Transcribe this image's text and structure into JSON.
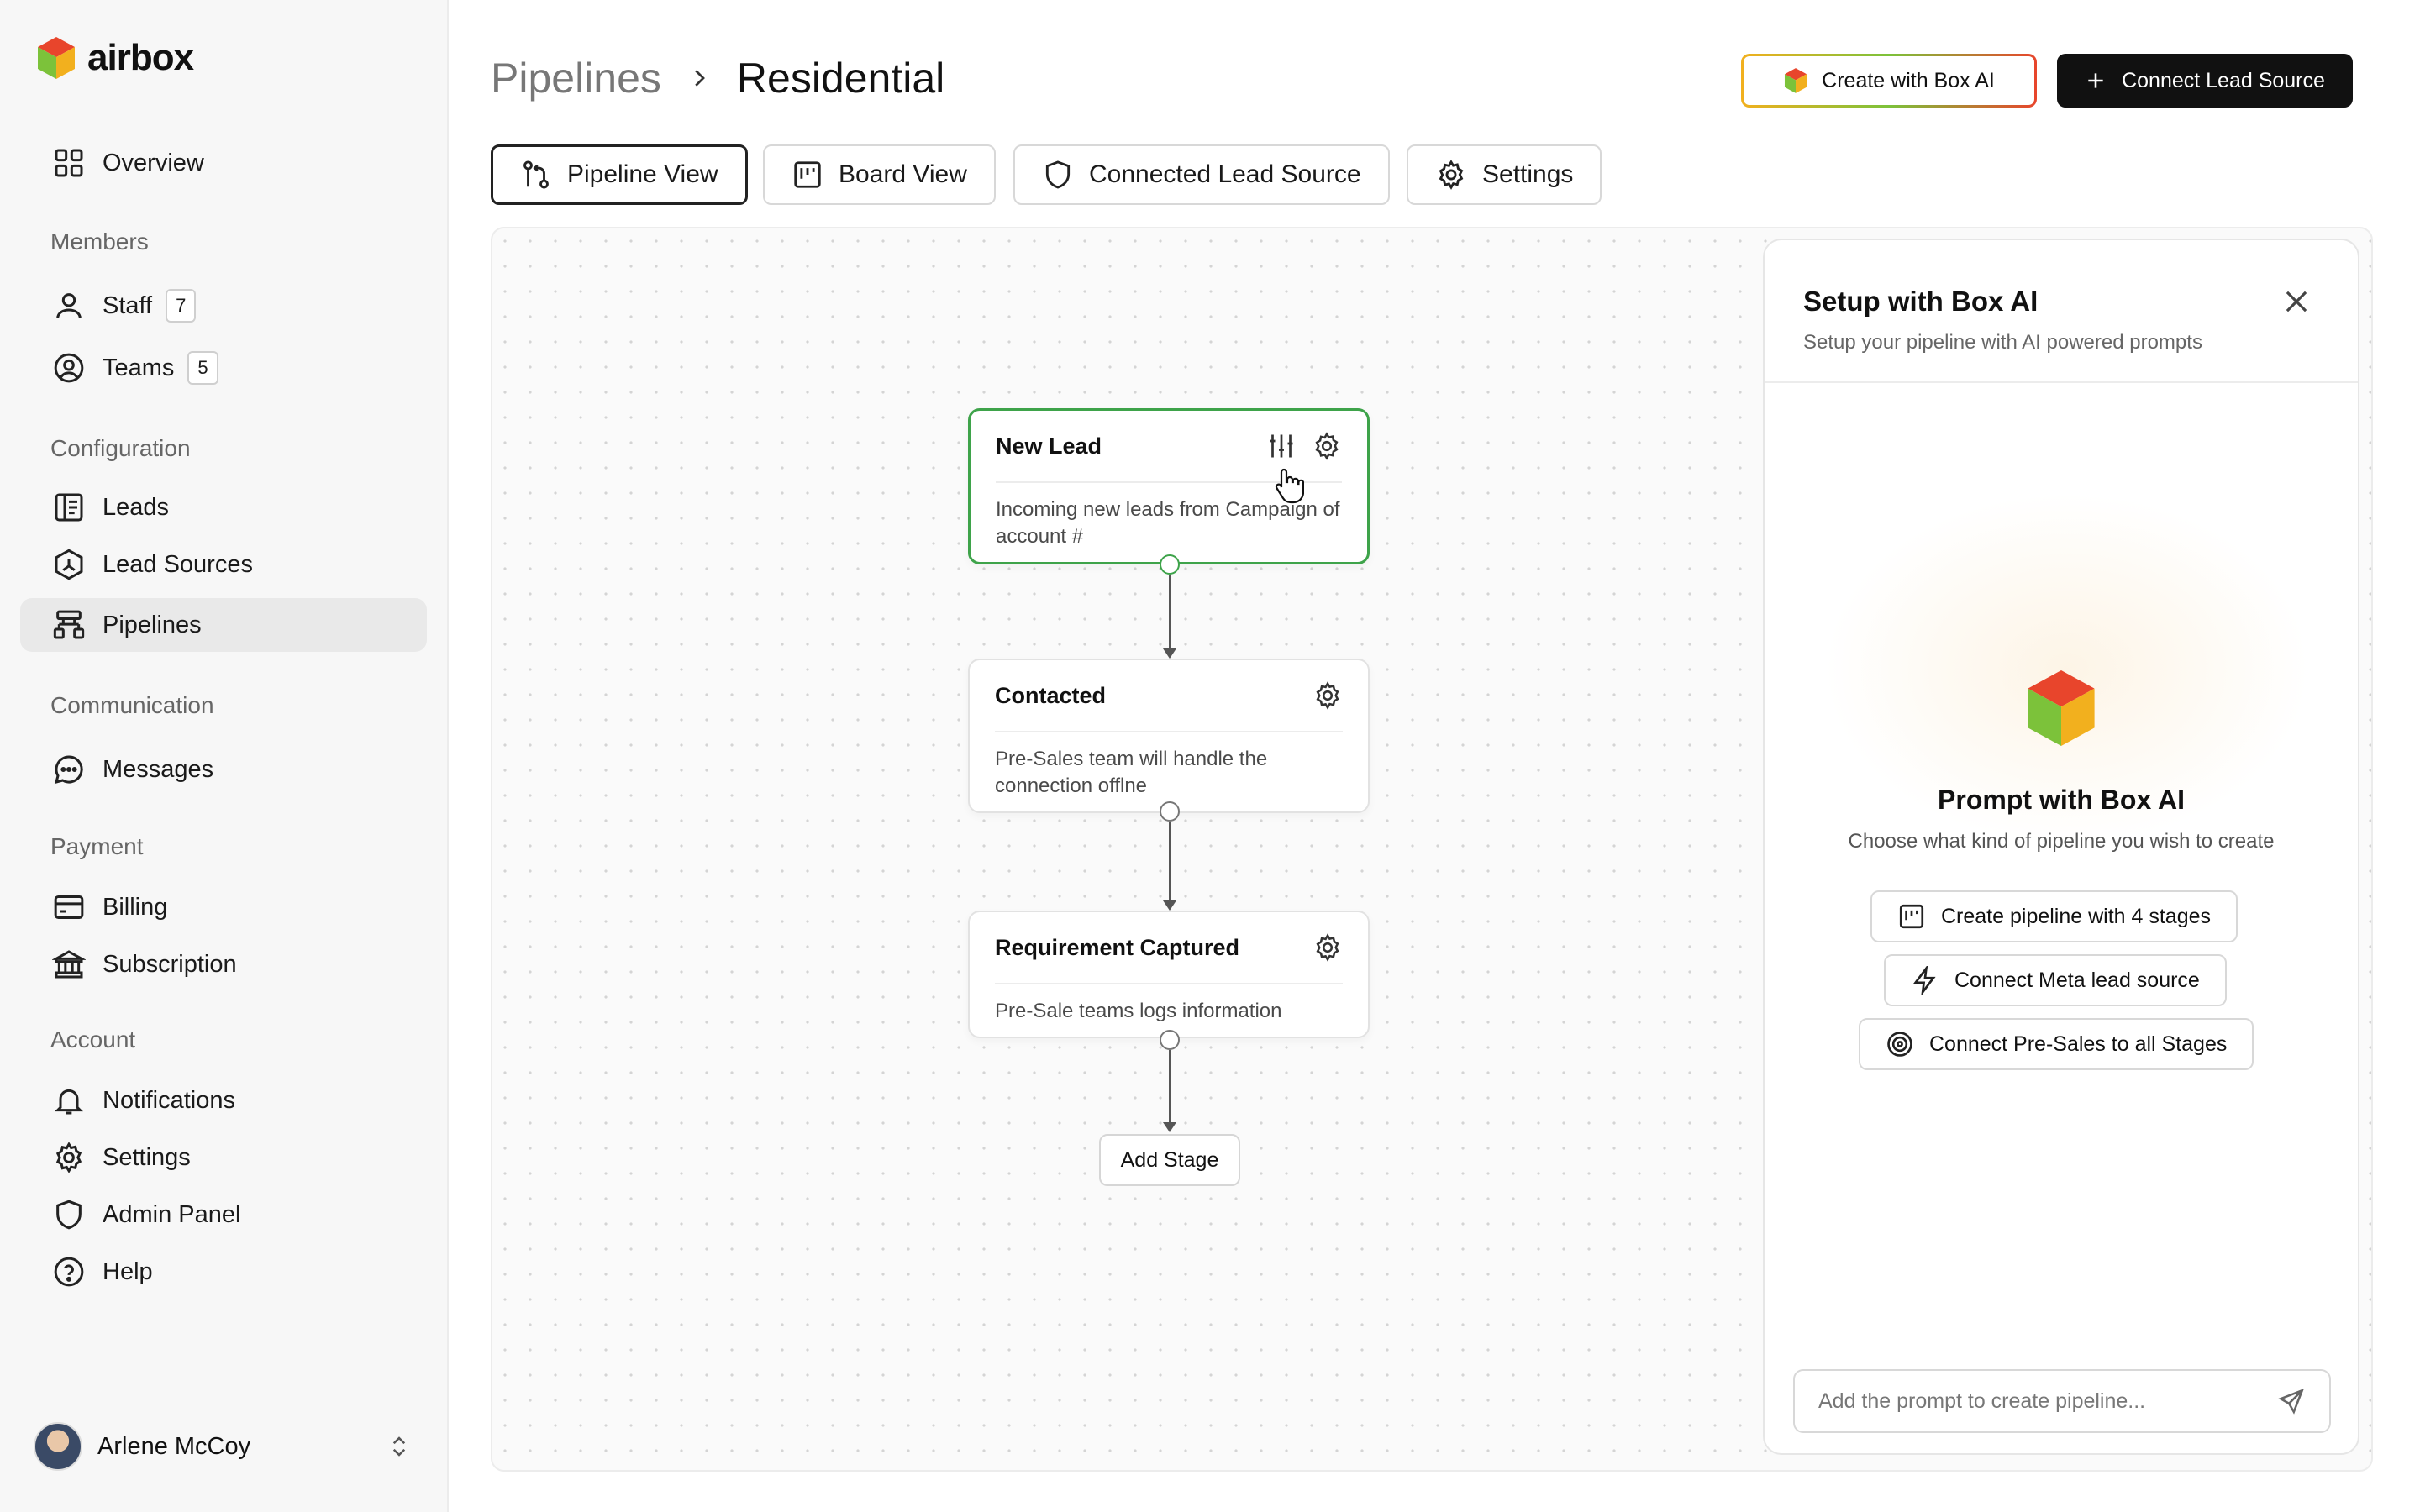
{
  "brand": {
    "name": "airbox"
  },
  "sidebar": {
    "items": [
      {
        "label": "Overview"
      },
      {
        "label": "Staff",
        "badge": "7"
      },
      {
        "label": "Teams",
        "badge": "5"
      },
      {
        "label": "Leads"
      },
      {
        "label": "Lead Sources"
      },
      {
        "label": "Pipelines"
      },
      {
        "label": "Messages"
      },
      {
        "label": "Billing"
      },
      {
        "label": "Subscription"
      },
      {
        "label": "Notifications"
      },
      {
        "label": "Settings"
      },
      {
        "label": "Admin Panel"
      },
      {
        "label": "Help"
      }
    ],
    "sections": [
      "Members",
      "Configuration",
      "Communication",
      "Payment",
      "Account"
    ],
    "active_item": "Pipelines"
  },
  "user": {
    "name": "Arlene McCoy"
  },
  "header": {
    "breadcrumb_parent": "Pipelines",
    "breadcrumb_current": "Residential",
    "create_ai_label": "Create with Box AI",
    "connect_label": "Connect Lead Source"
  },
  "tabs": [
    {
      "label": "Pipeline View",
      "active": true
    },
    {
      "label": "Board View"
    },
    {
      "label": "Connected Lead Source"
    },
    {
      "label": "Settings"
    }
  ],
  "stages": [
    {
      "title": "New Lead",
      "desc": "Incoming new leads from Campaign of account #",
      "selected": true
    },
    {
      "title": "Contacted",
      "desc": "Pre-Sales team will handle the connection offlne"
    },
    {
      "title": "Requirement Captured",
      "desc": "Pre-Sale teams logs information"
    }
  ],
  "add_stage_label": "Add Stage",
  "panel": {
    "title": "Setup with Box AI",
    "subtitle": "Setup your pipeline with AI powered prompts",
    "prompt_title": "Prompt with Box AI",
    "prompt_subtitle": "Choose what kind of pipeline you wish to create",
    "suggestions": [
      {
        "label": "Create pipeline with 4 stages",
        "icon": "board-icon"
      },
      {
        "label": "Connect Meta lead source",
        "icon": "lightning-icon"
      },
      {
        "label": "Connect Pre-Sales to all Stages",
        "icon": "target-icon"
      }
    ],
    "input_placeholder": "Add the prompt to create pipeline..."
  },
  "colors": {
    "accent_green": "#3ea34a",
    "primary": "#111111",
    "cube_red": "#e8452c",
    "cube_green": "#7cc23a",
    "cube_yellow": "#f2b01e"
  }
}
